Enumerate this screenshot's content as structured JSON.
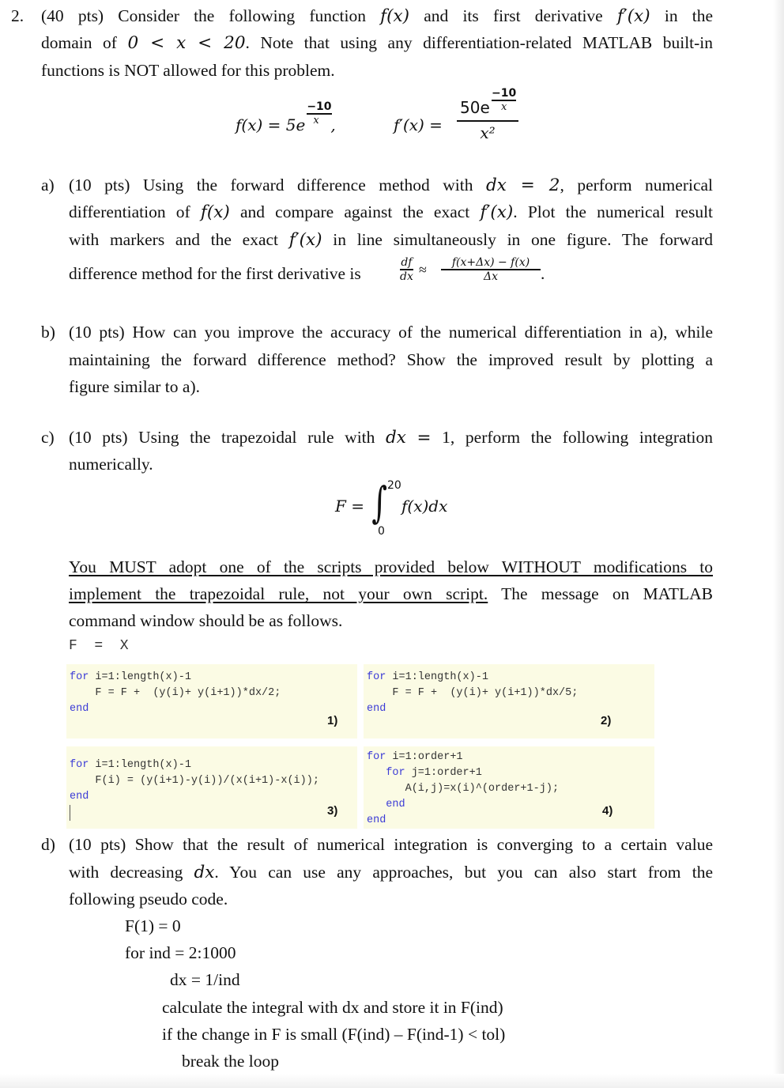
{
  "problem": {
    "number": "2.",
    "intro_lines": [
      "(40 pts) Consider the following function f(x) and its first derivative f′(x) in the",
      "domain of 0 < x < 20. Note that using any differentiation-related MATLAB built-in",
      "functions is NOT allowed for this problem."
    ],
    "intro": {
      "l1_a": "(40 pts) Consider the following function",
      "l1_b": "and its first derivative",
      "l1_c": "in the",
      "l2_a": "domain of",
      "l2_b": ". Note that using any differentiation-related MATLAB built-in",
      "l3": "functions is NOT allowed for this problem."
    },
    "math": {
      "fx": "f(x)",
      "fpx": "f′(x)",
      "domain": "0 < x < 20",
      "f_def_lhs": "f(x) = 5e",
      "f_exp_num": "−10",
      "f_exp_den": "x",
      "f_comma": ",",
      "fp_def_lhs": "f′(x) =",
      "fp_num": "50e",
      "fp_exp_num": "−10",
      "fp_exp_den": "x",
      "fp_den": "x²"
    }
  },
  "part_a": {
    "label": "a)",
    "l1_a": "(10 pts) Using the forward difference method with",
    "l1_math": "dx = 2",
    "l1_b": ", perform numerical",
    "l2_a": "differentiation of",
    "l2_b": "and compare against the exact",
    "l2_c": ". Plot the numerical result",
    "l3_a": "with markers and the exact",
    "l3_b": "in line simultaneously in one figure. The forward",
    "l4_a": "difference method for the first derivative is",
    "df": "df",
    "dx": "dx",
    "approx": "≈",
    "fd_num": "f(x+Δx) − f(x)",
    "fd_den": "Δx",
    "period": "."
  },
  "part_b": {
    "label": "b)",
    "lines": [
      "(10 pts) How can you improve the accuracy of the numerical differentiation in a), while",
      "maintaining the forward difference method? Show the improved result by plotting a",
      "figure similar to a)."
    ]
  },
  "part_c": {
    "label": "c)",
    "l1_a": "(10 pts) Using the trapezoidal rule with",
    "l1_math": "dx",
    "l1_eq": "=",
    "l1_b": "1, perform the following integration",
    "l2": "numerically.",
    "integral": {
      "lhs": "F =",
      "upper": "20",
      "lower": "0",
      "integrand": "f(x)dx"
    },
    "must_underlined_1": "You MUST adopt one of the scripts provided below WITHOUT modifications to",
    "must_underlined_2": "implement the trapezoidal rule, not your own script.",
    "must_rest": "The message on MATLAB",
    "must_l3": "command window should be as follows.",
    "output_example": "F  =  X",
    "scripts": [
      {
        "tag": "1)",
        "lines": [
          {
            "kw": "for",
            "text": " i=1:length(x)-1"
          },
          {
            "kw": "",
            "text": "    F = F +  (y(i)+ y(i+1))*dx/2;"
          },
          {
            "kw": "end",
            "text": ""
          }
        ]
      },
      {
        "tag": "2)",
        "lines": [
          {
            "kw": "for",
            "text": " i=1:length(x)-1"
          },
          {
            "kw": "",
            "text": "    F = F +  (y(i)+ y(i+1))*dx/5;"
          },
          {
            "kw": "end",
            "text": ""
          }
        ]
      },
      {
        "tag": "3)",
        "lines": [
          {
            "kw": "for",
            "text": " i=1:length(x)-1"
          },
          {
            "kw": "",
            "text": "    F(i) = (y(i+1)-y(i))/(x(i+1)-x(i));"
          },
          {
            "kw": "end",
            "text": ""
          }
        ]
      },
      {
        "tag": "4)",
        "lines": [
          {
            "kw": "for",
            "text": " i=1:order+1"
          },
          {
            "kw": "   for",
            "text": " j=1:order+1"
          },
          {
            "kw": "",
            "text": "      A(i,j)=x(i)^(order+1-j);"
          },
          {
            "kw": "   end",
            "text": ""
          },
          {
            "kw": "end",
            "text": ""
          }
        ]
      }
    ]
  },
  "part_d": {
    "label": "d)",
    "lines": [
      "(10 pts) Show that the result of numerical integration is converging to a certain value",
      "with decreasing dx. You can use any approaches, but you can also start from the",
      "following pseudo code."
    ],
    "l2_a": "with decreasing",
    "l2_math": "dx",
    "l2_b": ". You can use any approaches, but you can also start from the",
    "pseudo": [
      "F(1) = 0",
      "for ind = 2:1000",
      "dx = 1/ind",
      "calculate the integral with dx and store it in F(ind)",
      "if the change in F is small (F(ind) – F(ind-1) < tol)",
      "break the loop"
    ]
  },
  "colors": {
    "code_bg": "#fbfbe4",
    "keyword": "#3b3bd6",
    "text": "#111111"
  }
}
